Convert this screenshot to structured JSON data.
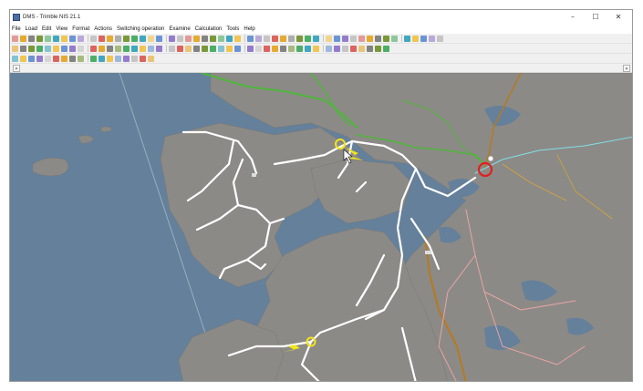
{
  "window": {
    "title": "DMS - Trimble NIS 21.1",
    "minimize_glyph": "–",
    "maximize_glyph": "☐",
    "close_glyph": "✕"
  },
  "menu": [
    {
      "label": "File"
    },
    {
      "label": "Load"
    },
    {
      "label": "Edit"
    },
    {
      "label": "View"
    },
    {
      "label": "Format"
    },
    {
      "label": "Actions"
    },
    {
      "label": "Switching operation"
    },
    {
      "label": "Examine"
    },
    {
      "label": "Calculation"
    },
    {
      "label": "Tools"
    },
    {
      "label": "Help"
    }
  ],
  "dock": {
    "left_toggle": "»",
    "right_toggle": "«"
  },
  "colors": {
    "sea": "#65809a",
    "land": "#8c8a86",
    "cable_white": "#ffffff",
    "line_green": "#4fb63c",
    "line_orange": "#b7791f",
    "line_pink": "#e8a4a4",
    "line_cyan": "#7fe0e8",
    "marker_yellow": "#f2e51b",
    "fault_red": "#e02020"
  },
  "icons": {
    "toolbar": [
      "select-icon",
      "zoom-in-icon",
      "zoom-out-icon",
      "pan-icon",
      "grid-icon",
      "layer-icon",
      "switch-icon",
      "breaker-icon",
      "transformer-icon",
      "cable-icon",
      "node-icon",
      "search-icon",
      "measure-icon",
      "print-icon",
      "save-icon",
      "undo-icon",
      "redo-icon",
      "text-icon"
    ],
    "markers": [
      "fault-marker-icon",
      "lightning-marker-icon",
      "station-marker-icon"
    ]
  }
}
